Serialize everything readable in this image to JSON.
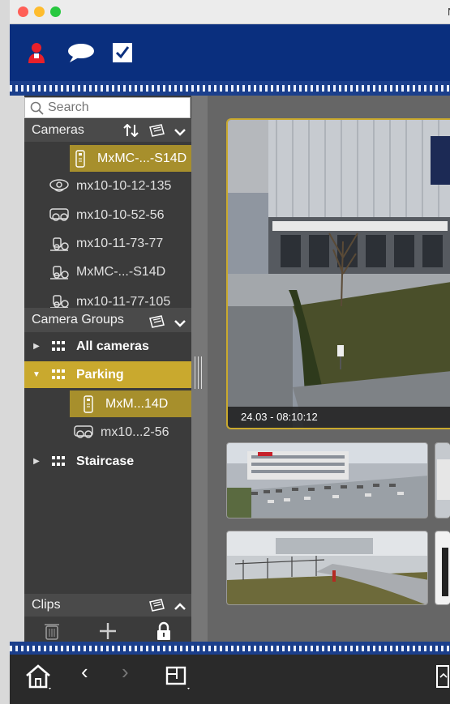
{
  "window": {
    "title_fragment": "N"
  },
  "search": {
    "placeholder": "Search"
  },
  "cameras": {
    "header": "Cameras",
    "items": [
      {
        "label": "MxMC-...-S14D",
        "icon": "door-station-icon",
        "selected": true
      },
      {
        "label": "mx10-10-12-135",
        "icon": "dome-camera-icon",
        "selected": false
      },
      {
        "label": "mx10-10-52-56",
        "icon": "dual-lens-camera-icon",
        "selected": false
      },
      {
        "label": "mx10-11-73-77",
        "icon": "bullet-camera-icon",
        "selected": false
      },
      {
        "label": "MxMC-...-S14D",
        "icon": "bullet-camera-icon",
        "selected": false
      },
      {
        "label": "mx10-11-77-105",
        "icon": "bullet-camera-icon",
        "selected": false
      }
    ]
  },
  "camera_groups": {
    "header": "Camera Groups",
    "groups": [
      {
        "label": "All cameras",
        "expanded": false
      },
      {
        "label": "Parking",
        "expanded": true,
        "children": [
          {
            "label": "MxM...14D",
            "icon": "door-station-icon"
          },
          {
            "label": "mx10...2-56",
            "icon": "dual-lens-camera-icon"
          }
        ]
      },
      {
        "label": "Staircase",
        "expanded": false
      }
    ]
  },
  "clips": {
    "header": "Clips"
  },
  "main_view": {
    "timestamp": "24.03 - 08:10:12"
  },
  "nav": {
    "prev": "‹",
    "next": "›"
  },
  "colors": {
    "toolbar": "#0a2f7e",
    "accent": "#c9a92e",
    "sidebar": "#3b3b3b"
  }
}
